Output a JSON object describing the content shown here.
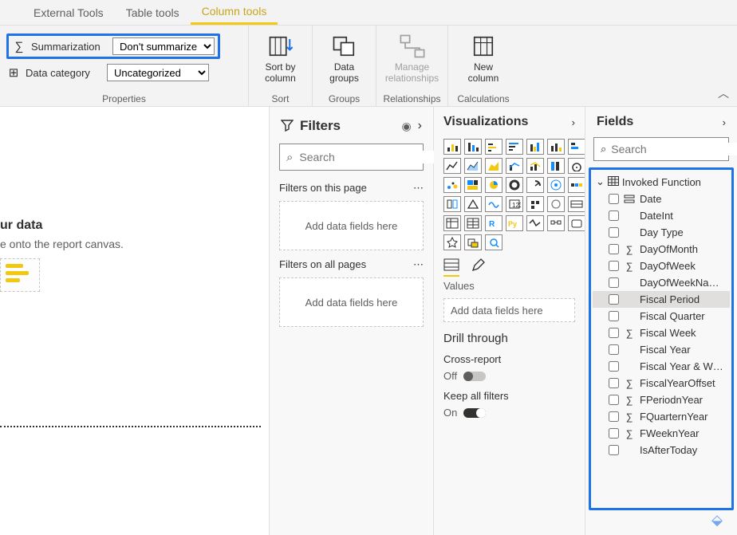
{
  "tabs": {
    "external": "External Tools",
    "table": "Table tools",
    "column": "Column tools"
  },
  "ribbon": {
    "properties": {
      "summarization_label": "Summarization",
      "summarization_value": "Don't summarize",
      "datacat_label": "Data category",
      "datacat_value": "Uncategorized",
      "group_label": "Properties"
    },
    "sort": {
      "button": "Sort by\ncolumn",
      "group_label": "Sort"
    },
    "groups": {
      "button": "Data\ngroups",
      "group_label": "Groups"
    },
    "relationships": {
      "button": "Manage\nrelationships",
      "group_label": "Relationships"
    },
    "calculations": {
      "button": "New\ncolumn",
      "group_label": "Calculations"
    }
  },
  "canvas": {
    "title": "ur data",
    "subtitle": "e onto the report canvas."
  },
  "filters": {
    "title": "Filters",
    "search_placeholder": "Search",
    "page_label": "Filters on this page",
    "all_label": "Filters on all pages",
    "drop_hint": "Add data fields here"
  },
  "vis": {
    "title": "Visualizations",
    "values_label": "Values",
    "values_hint": "Add data fields here",
    "drill_title": "Drill through",
    "cross_report": "Cross-report",
    "off": "Off",
    "keep_filters": "Keep all filters",
    "on": "On"
  },
  "fields": {
    "title": "Fields",
    "search_placeholder": "Search",
    "table_name": "Invoked Function",
    "items": [
      {
        "name": "Date",
        "icon": "hier"
      },
      {
        "name": "DateInt",
        "icon": ""
      },
      {
        "name": "Day Type",
        "icon": ""
      },
      {
        "name": "DayOfMonth",
        "icon": "sum"
      },
      {
        "name": "DayOfWeek",
        "icon": "sum"
      },
      {
        "name": "DayOfWeekNa…",
        "icon": ""
      },
      {
        "name": "Fiscal Period",
        "icon": "",
        "selected": true
      },
      {
        "name": "Fiscal Quarter",
        "icon": ""
      },
      {
        "name": "Fiscal Week",
        "icon": "sum"
      },
      {
        "name": "Fiscal Year",
        "icon": ""
      },
      {
        "name": "Fiscal Year & W…",
        "icon": ""
      },
      {
        "name": "FiscalYearOffset",
        "icon": "sum"
      },
      {
        "name": "FPeriodnYear",
        "icon": "sum"
      },
      {
        "name": "FQuarternYear",
        "icon": "sum"
      },
      {
        "name": "FWeeknYear",
        "icon": "sum"
      },
      {
        "name": "IsAfterToday",
        "icon": ""
      }
    ]
  }
}
